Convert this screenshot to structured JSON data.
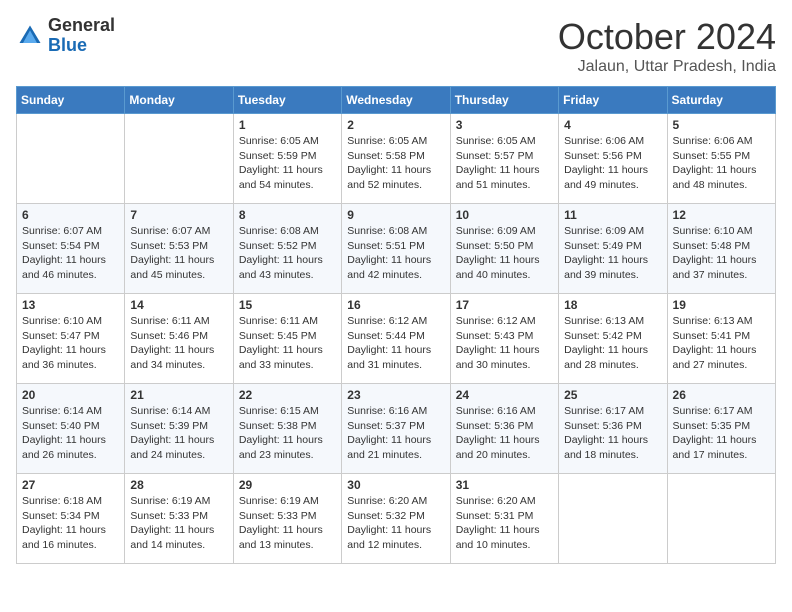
{
  "header": {
    "logo_general": "General",
    "logo_blue": "Blue",
    "title": "October 2024",
    "location": "Jalaun, Uttar Pradesh, India"
  },
  "weekdays": [
    "Sunday",
    "Monday",
    "Tuesday",
    "Wednesday",
    "Thursday",
    "Friday",
    "Saturday"
  ],
  "weeks": [
    [
      {
        "day": "",
        "info": ""
      },
      {
        "day": "",
        "info": ""
      },
      {
        "day": "1",
        "info": "Sunrise: 6:05 AM\nSunset: 5:59 PM\nDaylight: 11 hours and 54 minutes."
      },
      {
        "day": "2",
        "info": "Sunrise: 6:05 AM\nSunset: 5:58 PM\nDaylight: 11 hours and 52 minutes."
      },
      {
        "day": "3",
        "info": "Sunrise: 6:05 AM\nSunset: 5:57 PM\nDaylight: 11 hours and 51 minutes."
      },
      {
        "day": "4",
        "info": "Sunrise: 6:06 AM\nSunset: 5:56 PM\nDaylight: 11 hours and 49 minutes."
      },
      {
        "day": "5",
        "info": "Sunrise: 6:06 AM\nSunset: 5:55 PM\nDaylight: 11 hours and 48 minutes."
      }
    ],
    [
      {
        "day": "6",
        "info": "Sunrise: 6:07 AM\nSunset: 5:54 PM\nDaylight: 11 hours and 46 minutes."
      },
      {
        "day": "7",
        "info": "Sunrise: 6:07 AM\nSunset: 5:53 PM\nDaylight: 11 hours and 45 minutes."
      },
      {
        "day": "8",
        "info": "Sunrise: 6:08 AM\nSunset: 5:52 PM\nDaylight: 11 hours and 43 minutes."
      },
      {
        "day": "9",
        "info": "Sunrise: 6:08 AM\nSunset: 5:51 PM\nDaylight: 11 hours and 42 minutes."
      },
      {
        "day": "10",
        "info": "Sunrise: 6:09 AM\nSunset: 5:50 PM\nDaylight: 11 hours and 40 minutes."
      },
      {
        "day": "11",
        "info": "Sunrise: 6:09 AM\nSunset: 5:49 PM\nDaylight: 11 hours and 39 minutes."
      },
      {
        "day": "12",
        "info": "Sunrise: 6:10 AM\nSunset: 5:48 PM\nDaylight: 11 hours and 37 minutes."
      }
    ],
    [
      {
        "day": "13",
        "info": "Sunrise: 6:10 AM\nSunset: 5:47 PM\nDaylight: 11 hours and 36 minutes."
      },
      {
        "day": "14",
        "info": "Sunrise: 6:11 AM\nSunset: 5:46 PM\nDaylight: 11 hours and 34 minutes."
      },
      {
        "day": "15",
        "info": "Sunrise: 6:11 AM\nSunset: 5:45 PM\nDaylight: 11 hours and 33 minutes."
      },
      {
        "day": "16",
        "info": "Sunrise: 6:12 AM\nSunset: 5:44 PM\nDaylight: 11 hours and 31 minutes."
      },
      {
        "day": "17",
        "info": "Sunrise: 6:12 AM\nSunset: 5:43 PM\nDaylight: 11 hours and 30 minutes."
      },
      {
        "day": "18",
        "info": "Sunrise: 6:13 AM\nSunset: 5:42 PM\nDaylight: 11 hours and 28 minutes."
      },
      {
        "day": "19",
        "info": "Sunrise: 6:13 AM\nSunset: 5:41 PM\nDaylight: 11 hours and 27 minutes."
      }
    ],
    [
      {
        "day": "20",
        "info": "Sunrise: 6:14 AM\nSunset: 5:40 PM\nDaylight: 11 hours and 26 minutes."
      },
      {
        "day": "21",
        "info": "Sunrise: 6:14 AM\nSunset: 5:39 PM\nDaylight: 11 hours and 24 minutes."
      },
      {
        "day": "22",
        "info": "Sunrise: 6:15 AM\nSunset: 5:38 PM\nDaylight: 11 hours and 23 minutes."
      },
      {
        "day": "23",
        "info": "Sunrise: 6:16 AM\nSunset: 5:37 PM\nDaylight: 11 hours and 21 minutes."
      },
      {
        "day": "24",
        "info": "Sunrise: 6:16 AM\nSunset: 5:36 PM\nDaylight: 11 hours and 20 minutes."
      },
      {
        "day": "25",
        "info": "Sunrise: 6:17 AM\nSunset: 5:36 PM\nDaylight: 11 hours and 18 minutes."
      },
      {
        "day": "26",
        "info": "Sunrise: 6:17 AM\nSunset: 5:35 PM\nDaylight: 11 hours and 17 minutes."
      }
    ],
    [
      {
        "day": "27",
        "info": "Sunrise: 6:18 AM\nSunset: 5:34 PM\nDaylight: 11 hours and 16 minutes."
      },
      {
        "day": "28",
        "info": "Sunrise: 6:19 AM\nSunset: 5:33 PM\nDaylight: 11 hours and 14 minutes."
      },
      {
        "day": "29",
        "info": "Sunrise: 6:19 AM\nSunset: 5:33 PM\nDaylight: 11 hours and 13 minutes."
      },
      {
        "day": "30",
        "info": "Sunrise: 6:20 AM\nSunset: 5:32 PM\nDaylight: 11 hours and 12 minutes."
      },
      {
        "day": "31",
        "info": "Sunrise: 6:20 AM\nSunset: 5:31 PM\nDaylight: 11 hours and 10 minutes."
      },
      {
        "day": "",
        "info": ""
      },
      {
        "day": "",
        "info": ""
      }
    ]
  ]
}
